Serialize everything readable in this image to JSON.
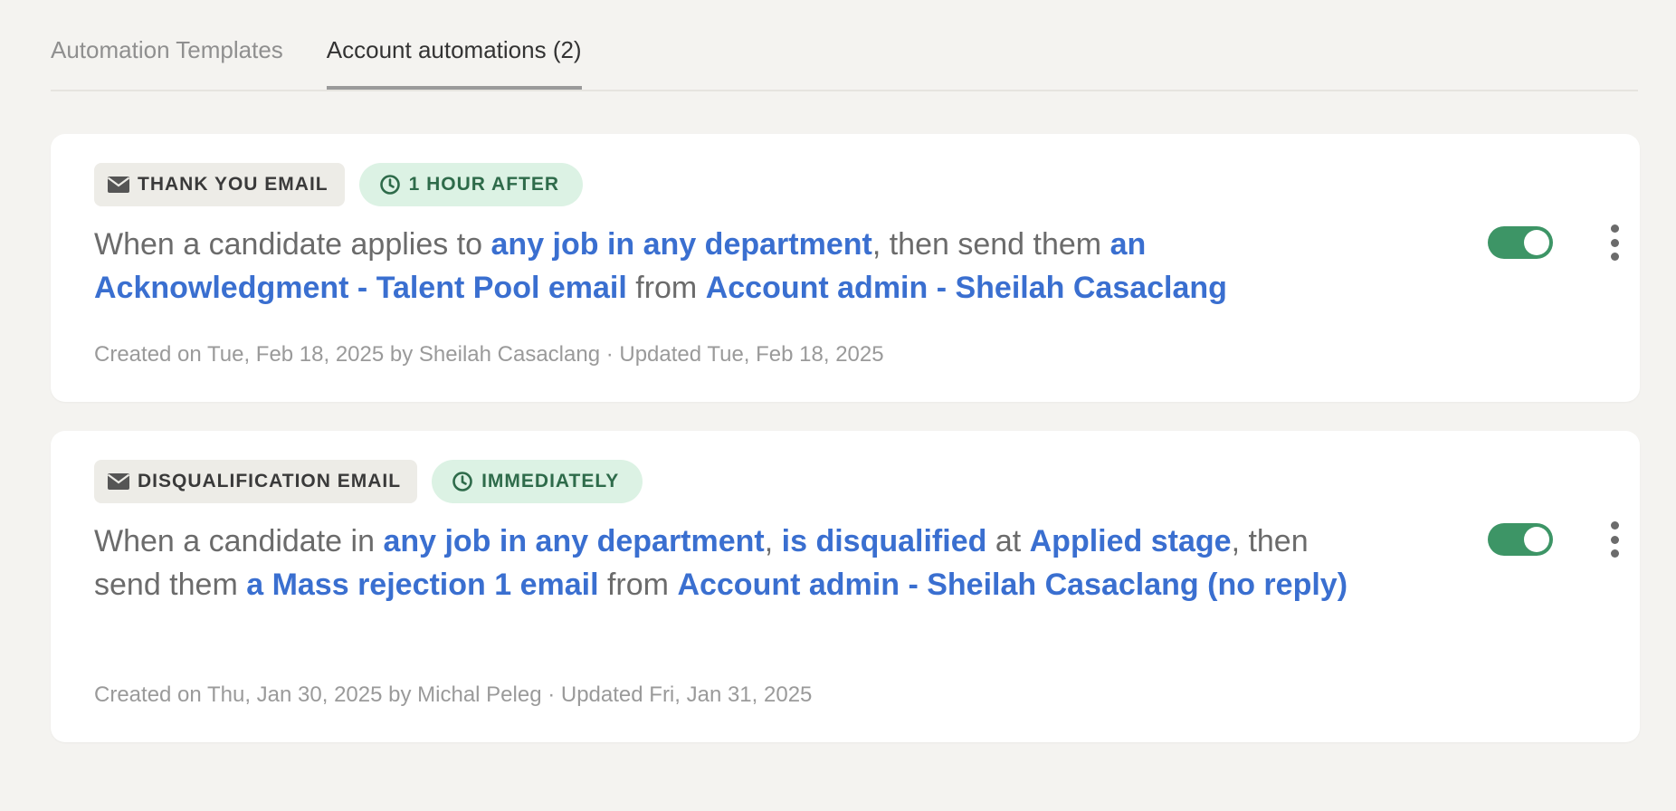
{
  "colors": {
    "accent_link": "#3a6fd0",
    "toggle_on": "#3d9566",
    "timing_badge_bg": "#dcf2e4",
    "type_badge_bg": "#edece7"
  },
  "tabs": [
    {
      "label": "Automation Templates",
      "active": false
    },
    {
      "label": "Account automations (2)",
      "active": true
    }
  ],
  "automations": [
    {
      "type_icon": "envelope-icon",
      "type_label": "THANK YOU EMAIL",
      "timing_icon": "clock-icon",
      "timing_label": "1 HOUR AFTER",
      "description": {
        "t1": "When a candidate applies to ",
        "l1": "any job in any department",
        "t2": ", then send them ",
        "l2": "an Acknowledgment - Talent Pool email",
        "t3": " from ",
        "l3": "Account admin - Sheilah Casaclang"
      },
      "meta": "Created on Tue, Feb 18, 2025 by Sheilah Casaclang · Updated Tue, Feb 18, 2025",
      "enabled": true
    },
    {
      "type_icon": "envelope-icon",
      "type_label": "DISQUALIFICATION EMAIL",
      "timing_icon": "clock-icon",
      "timing_label": "IMMEDIATELY",
      "description": {
        "t1": "When a candidate in ",
        "l1": "any job in any department",
        "t2": ", ",
        "l2": "is disqualified",
        "t3": " at ",
        "l3": "Applied stage",
        "t4": ", then send them ",
        "l4": "a Mass rejection 1 email",
        "t5": " from ",
        "l5": "Account admin - Sheilah Casaclang (no reply)"
      },
      "meta": "Created on Thu, Jan 30, 2025 by Michal Peleg · Updated Fri, Jan 31, 2025",
      "enabled": true
    }
  ]
}
